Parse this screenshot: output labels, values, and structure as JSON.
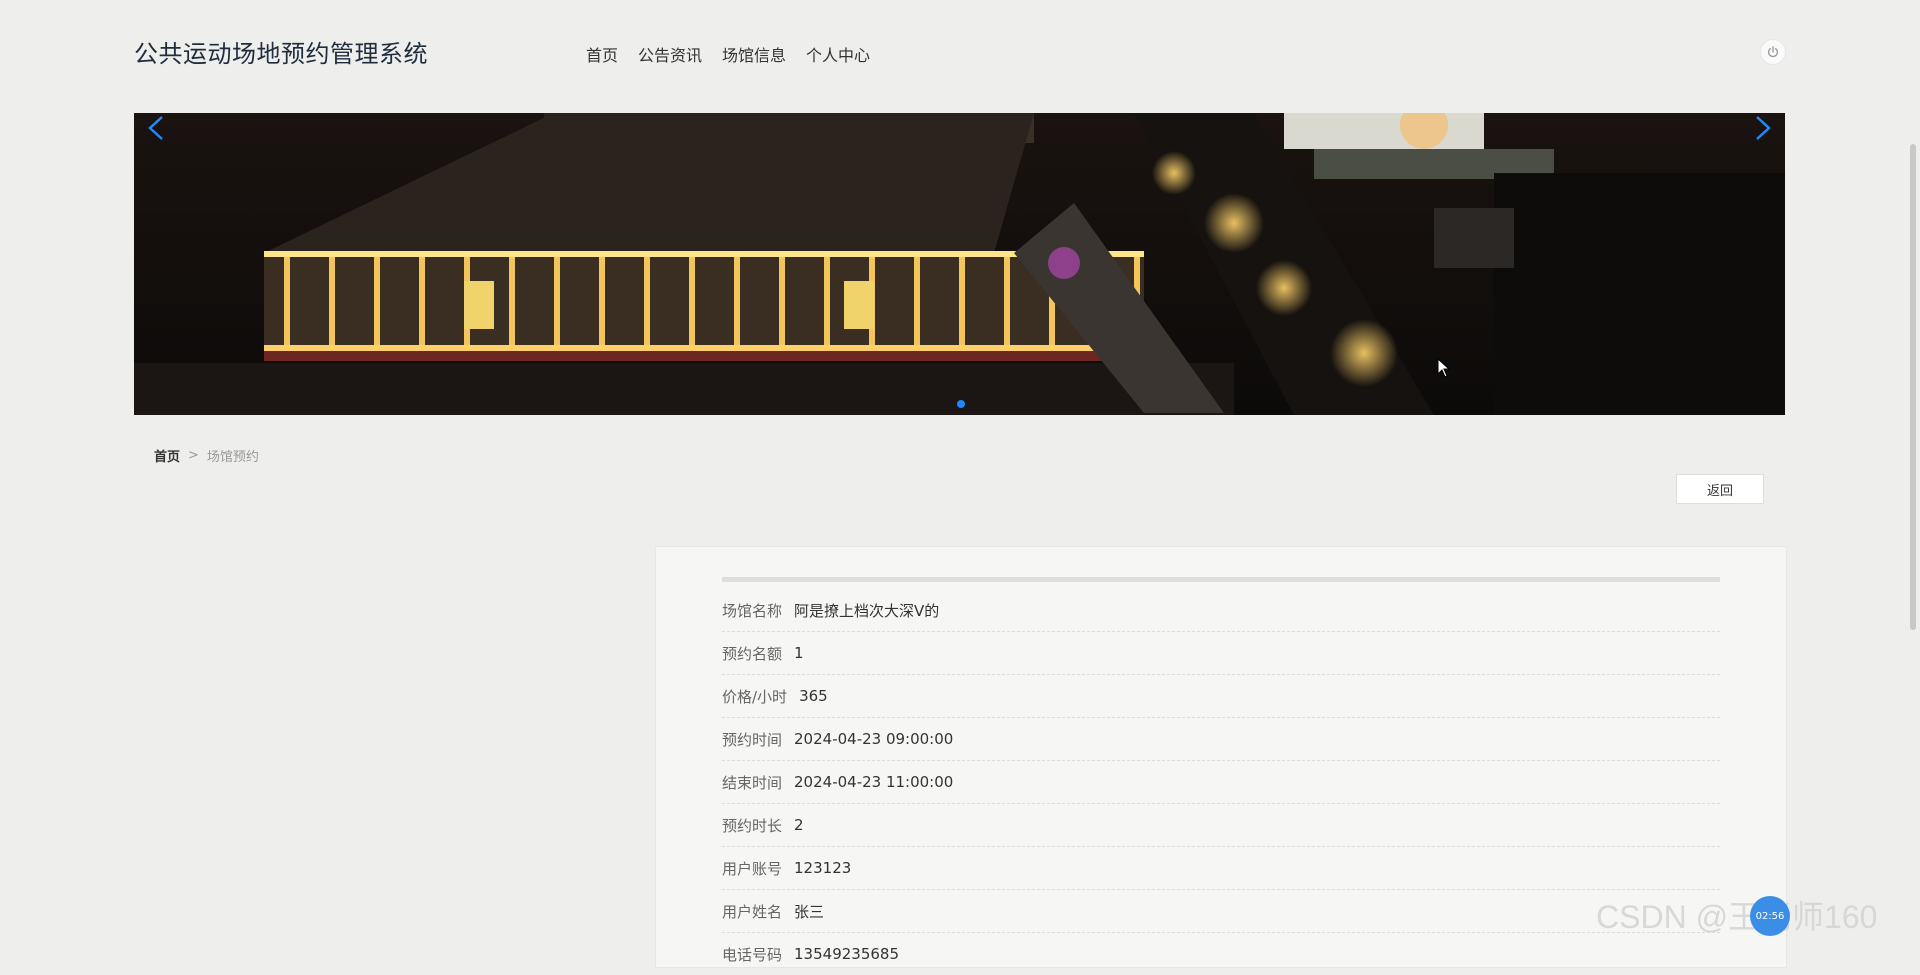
{
  "header": {
    "title": "公共运动场地预约管理系统",
    "nav": [
      "首页",
      "公告资讯",
      "场馆信息",
      "个人中心"
    ]
  },
  "breadcrumb": {
    "home": "首页",
    "separator": ">",
    "current": "场馆预约"
  },
  "back_button": "返回",
  "details": [
    {
      "label": "场馆名称",
      "value": "阿是撩上档次大深V的"
    },
    {
      "label": "预约名额",
      "value": "1"
    },
    {
      "label": "价格/小时",
      "value": "365"
    },
    {
      "label": "预约时间",
      "value": "2024-04-23 09:00:00"
    },
    {
      "label": "结束时间",
      "value": "2024-04-23 11:00:00"
    },
    {
      "label": "预约时长",
      "value": "2"
    },
    {
      "label": "用户账号",
      "value": "123123"
    },
    {
      "label": "用户姓名",
      "value": "张三"
    },
    {
      "label": "电话号码",
      "value": "13549235685"
    }
  ],
  "watermark": "CSDN @王老师160",
  "clock_badge": "02:56",
  "colors": {
    "accent": "#1e88ff",
    "background": "#eeeeec"
  }
}
